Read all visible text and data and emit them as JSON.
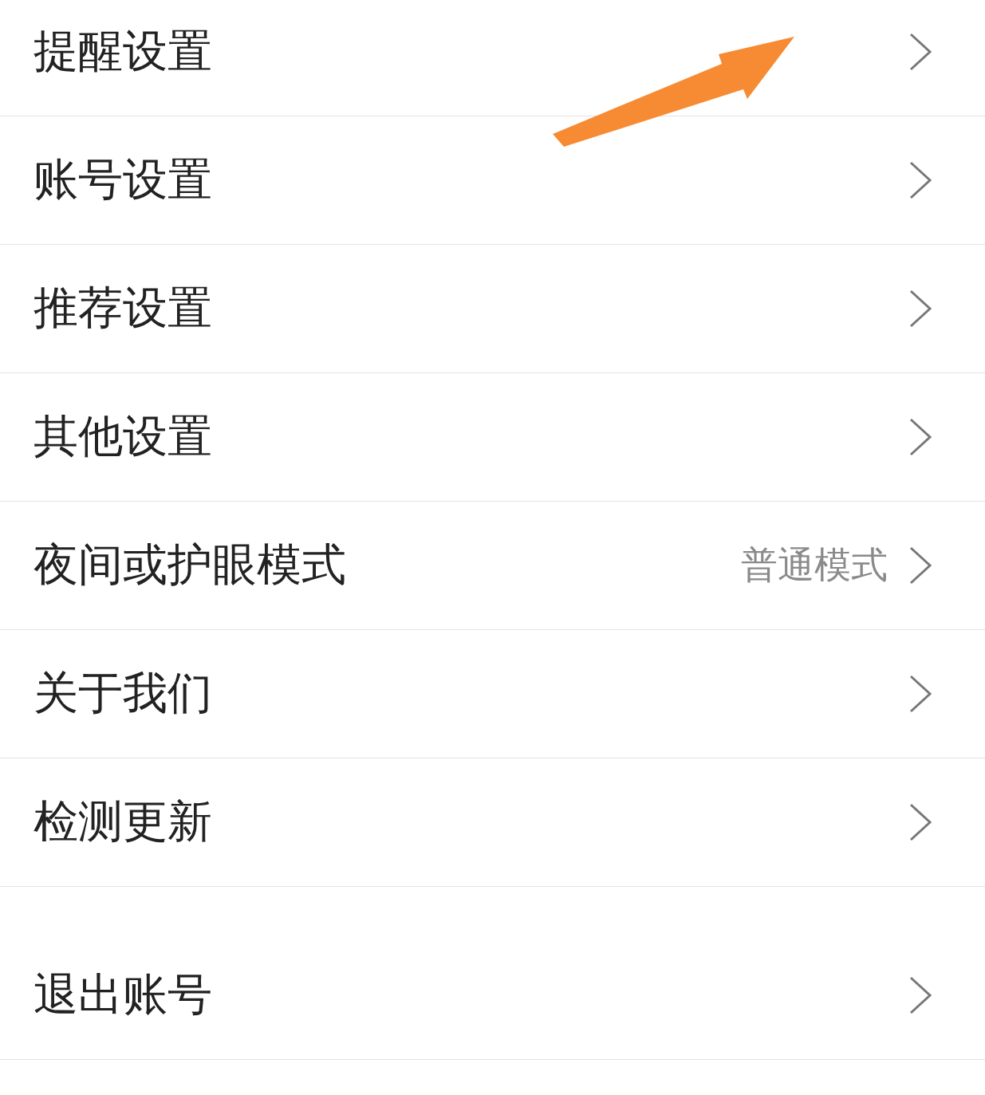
{
  "groups": [
    {
      "items": [
        {
          "label": "提醒设置"
        },
        {
          "label": "账号设置"
        },
        {
          "label": "推荐设置"
        },
        {
          "label": "其他设置"
        },
        {
          "label": "夜间或护眼模式",
          "value": "普通模式"
        },
        {
          "label": "关于我们"
        },
        {
          "label": "检测更新"
        }
      ]
    },
    {
      "items": [
        {
          "label": "退出账号"
        }
      ]
    }
  ]
}
